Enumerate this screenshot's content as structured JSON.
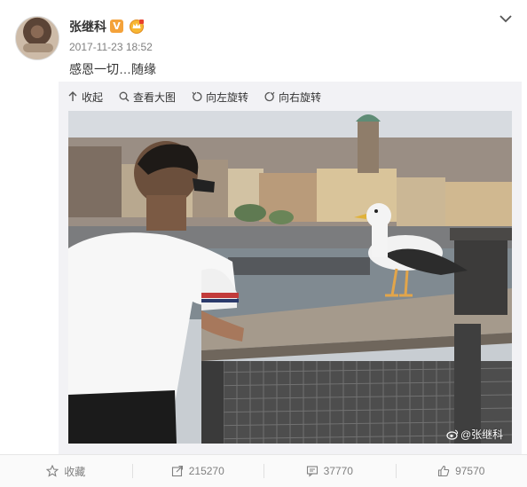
{
  "post": {
    "username": "张继科",
    "verified_badge": "V",
    "vip_badge_icon": "vip-crown-icon",
    "time": "2017-11-23 18:52",
    "text": "感恩一切…随缘"
  },
  "media_tools": {
    "collapse": "收起",
    "view_large": "查看大图",
    "rotate_left": "向左旋转",
    "rotate_right": "向右旋转"
  },
  "photo": {
    "watermark": "@张继科",
    "description_icon": "weibo-icon"
  },
  "actions": {
    "favorite": "收藏",
    "repost": "215270",
    "comment": "37770",
    "like": "97570"
  },
  "colors": {
    "badge_orange": "#f4a23a",
    "text_gray": "#808080",
    "media_bg": "#f2f2f5"
  }
}
